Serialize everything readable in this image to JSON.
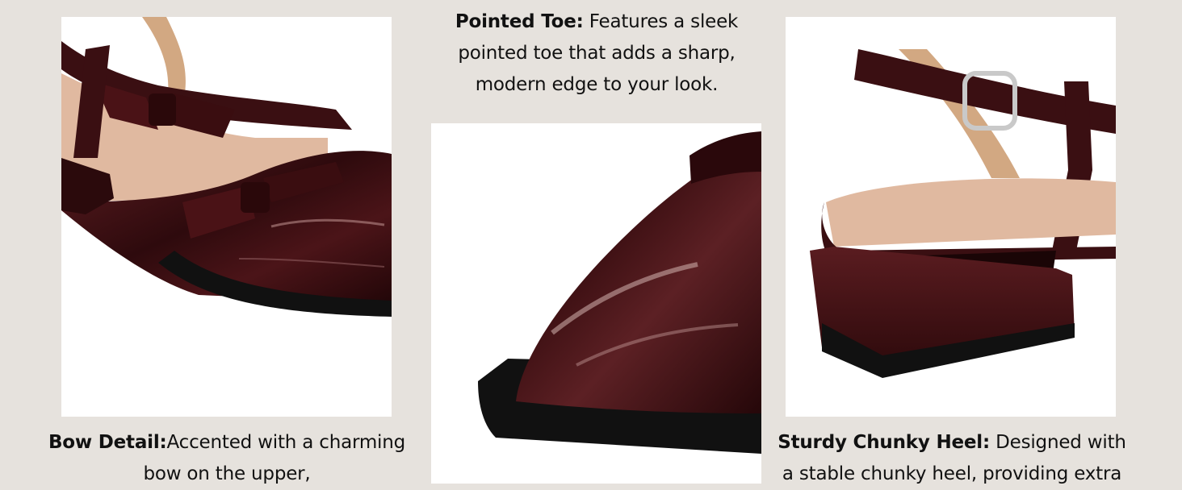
{
  "features": {
    "pointed_toe": {
      "title": "Pointed Toe:",
      "text": " Features a sleek pointed toe that adds a sharp, modern edge to your look."
    },
    "bow_detail": {
      "title": "Bow Detail:",
      "text": "Accented with a charming bow on the upper,"
    },
    "chunky_heel": {
      "title": "Sturdy Chunky Heel:",
      "text": " Designed with a stable chunky heel, providing extra"
    }
  },
  "colors": {
    "background": "#e6e2dd",
    "patent_leather": "#3a0f12",
    "lining": "#e0b9a0",
    "sole": "#111111"
  }
}
